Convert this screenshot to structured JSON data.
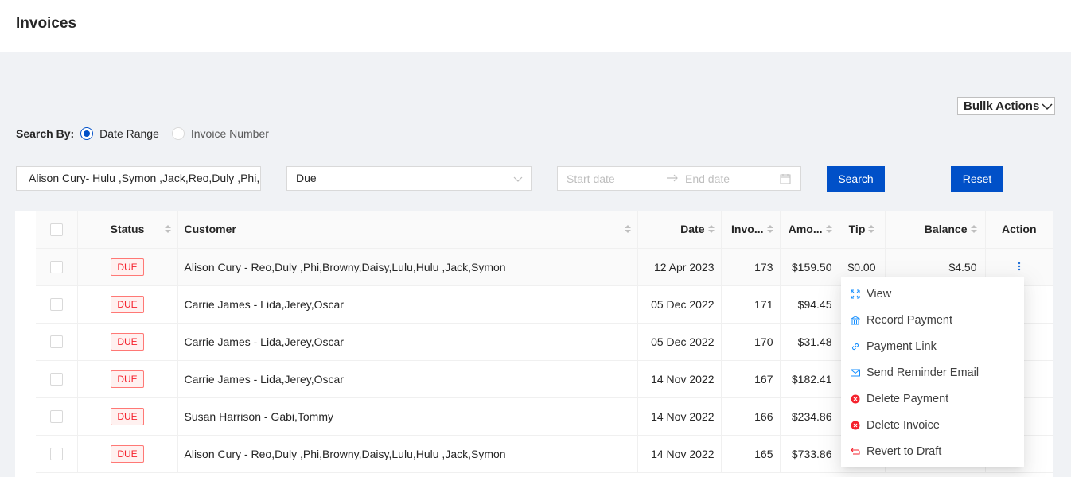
{
  "page": {
    "title": "Invoices"
  },
  "toolbar": {
    "bulk_actions_label": "Bullk Actions"
  },
  "search": {
    "label": "Search By:",
    "options": [
      "Date Range",
      "Invoice Number"
    ],
    "selected": "Date Range",
    "customer_value": "Alison Cury- Hulu ,Symon ,Jack,Reo,Duly ,Phi,Browny,Daisy,Lulu",
    "status_value": "Due",
    "start_placeholder": "Start date",
    "end_placeholder": "End date",
    "search_label": "Search",
    "reset_label": "Reset"
  },
  "table": {
    "columns": [
      "Status",
      "Customer",
      "Date",
      "Invo...",
      "Amo...",
      "Tip",
      "Balance",
      "Action"
    ],
    "rows": [
      {
        "status": "DUE",
        "customer": "Alison Cury - Reo,Duly ,Phi,Browny,Daisy,Lulu,Hulu ,Jack,Symon",
        "date": "12 Apr 2023",
        "invoice": "173",
        "amount": "$159.50",
        "tip": "$0.00",
        "balance": "$4.50"
      },
      {
        "status": "DUE",
        "customer": "Carrie James - Lida,Jerey,Oscar",
        "date": "05 Dec 2022",
        "invoice": "171",
        "amount": "$94.45"
      },
      {
        "status": "DUE",
        "customer": "Carrie James - Lida,Jerey,Oscar",
        "date": "05 Dec 2022",
        "invoice": "170",
        "amount": "$31.48"
      },
      {
        "status": "DUE",
        "customer": "Carrie James - Lida,Jerey,Oscar",
        "date": "14 Nov 2022",
        "invoice": "167",
        "amount": "$182.41"
      },
      {
        "status": "DUE",
        "customer": "Susan Harrison - Gabi,Tommy",
        "date": "14 Nov 2022",
        "invoice": "166",
        "amount": "$234.86"
      },
      {
        "status": "DUE",
        "customer": "Alison Cury - Reo,Duly ,Phi,Browny,Daisy,Lulu,Hulu ,Jack,Symon",
        "date": "14 Nov 2022",
        "invoice": "165",
        "amount": "$733.86"
      }
    ]
  },
  "action_menu": {
    "items": [
      {
        "label": "View",
        "icon": "expand-icon",
        "color": "#1890ff"
      },
      {
        "label": "Record Payment",
        "icon": "bank-icon",
        "color": "#1890ff"
      },
      {
        "label": "Payment Link",
        "icon": "link-icon",
        "color": "#1890ff"
      },
      {
        "label": "Send Reminder Email",
        "icon": "mail-icon",
        "color": "#1890ff"
      },
      {
        "label": "Delete Payment",
        "icon": "close-circle-icon",
        "color": "#f5222d"
      },
      {
        "label": "Delete Invoice",
        "icon": "close-circle-icon",
        "color": "#f5222d"
      },
      {
        "label": "Revert to Draft",
        "icon": "rollback-icon",
        "color": "#f5222d"
      }
    ]
  }
}
